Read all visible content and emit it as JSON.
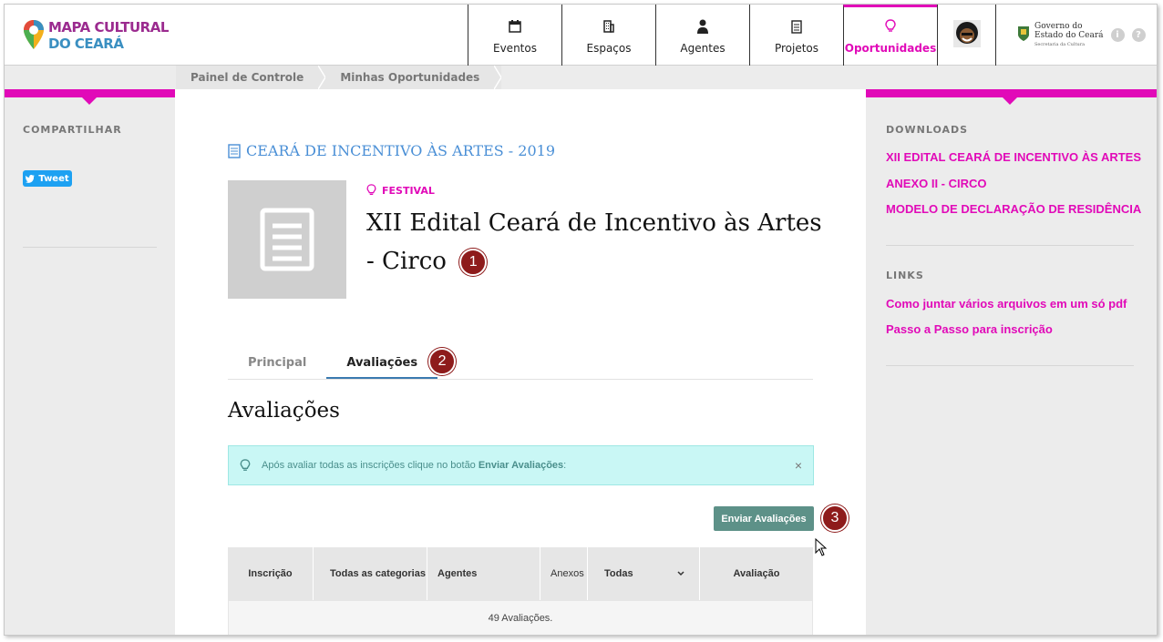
{
  "header": {
    "logo_line1": "MAPA CULTURAL",
    "logo_line2": "DO CEARÁ",
    "nav": [
      {
        "label": "Eventos",
        "icon": "calendar-icon"
      },
      {
        "label": "Espaços",
        "icon": "building-icon"
      },
      {
        "label": "Agentes",
        "icon": "person-icon"
      },
      {
        "label": "Projetos",
        "icon": "document-icon"
      },
      {
        "label": "Oportunidades",
        "icon": "lightbulb-icon",
        "active": true
      }
    ],
    "gov_line1": "Governo do",
    "gov_line2": "Estado do Ceará",
    "gov_line3": "Secretaria da Cultura",
    "info_icon": "i",
    "help_icon": "?"
  },
  "breadcrumb": [
    "Painel de Controle",
    "Minhas Oportunidades"
  ],
  "left": {
    "share_title": "COMPARTILHAR",
    "tweet_label": "Tweet"
  },
  "right": {
    "downloads_title": "DOWNLOADS",
    "downloads": [
      "XII EDITAL CEARÁ DE INCENTIVO ÀS ARTES",
      "ANEXO II - CIRCO",
      "MODELO DE DECLARAÇÃO DE RESIDÊNCIA"
    ],
    "links_title": "LINKS",
    "links": [
      "Como juntar vários arquivos em um só pdf",
      "Passo a Passo para inscrição"
    ]
  },
  "main": {
    "project_link": "CEARÁ DE INCENTIVO ÀS ARTES - 2019",
    "type": "FESTIVAL",
    "title_line1": "XII Edital Ceará de Incentivo às Artes",
    "title_line2": "- Circo",
    "markers": [
      "1",
      "2",
      "3"
    ],
    "tabs": [
      "Principal",
      "Avaliações"
    ],
    "section_title": "Avaliações",
    "alert_text": "Após avaliar todas as inscrições clique no botão",
    "alert_bold": "Enviar Avaliações",
    "alert_tail": ":",
    "alert_close": "×",
    "send_button": "Enviar Avaliações",
    "table_headers": [
      "Inscrição",
      "Todas as categorias",
      "Agentes",
      "Anexos",
      "Todas",
      "Avaliação"
    ],
    "table_footer": "49 Avaliações."
  },
  "colors": {
    "accent": "#e10ab8",
    "link_blue": "#4a8fd6",
    "button": "#5d9188",
    "marker": "#8e1b1b"
  }
}
